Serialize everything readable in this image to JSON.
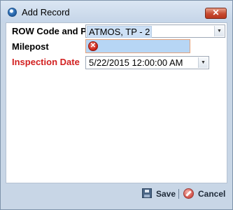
{
  "window": {
    "title": "Add Record",
    "close_glyph": "✕"
  },
  "form": {
    "row_code": {
      "label": "ROW Code and Pipe",
      "value": "ATMOS, TP - 2"
    },
    "milepost": {
      "label": "Milepost",
      "value": "",
      "error_glyph": "✕"
    },
    "inspection_date": {
      "label": "Inspection Date",
      "value": "5/22/2015 12:00:00 AM"
    },
    "dropdown_glyph": "▼"
  },
  "footer": {
    "save_label": "Save",
    "cancel_label": "Cancel"
  },
  "colors": {
    "required_label": "#d21f1f",
    "error_field_bg": "#b7d6f5",
    "window_frame": "#c8d6e6"
  },
  "icons": [
    "app-icon",
    "close-icon",
    "error-icon",
    "chevron-down-icon",
    "save-icon",
    "cancel-icon"
  ]
}
